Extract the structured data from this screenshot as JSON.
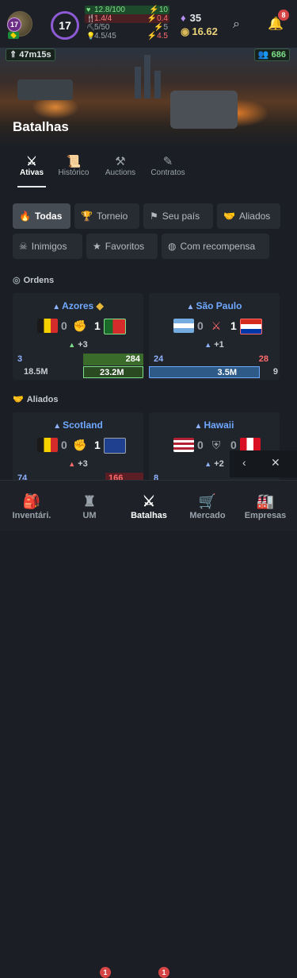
{
  "header": {
    "player_level": "17",
    "level": "17",
    "stats": [
      {
        "left": "12.8/100",
        "right": "10"
      },
      {
        "left": "1.4/4",
        "right": "0.4"
      },
      {
        "left": "5/50",
        "right": "5"
      },
      {
        "left": "4.5/45",
        "right": "4.5"
      }
    ],
    "gems": "35",
    "coins": "16.62",
    "notifications": "8",
    "timer": "47m15s",
    "online": "686"
  },
  "hero": {
    "title": "Batalhas"
  },
  "tabs": [
    {
      "label": "Ativas"
    },
    {
      "label": "Histórico"
    },
    {
      "label": "Auctions"
    },
    {
      "label": "Contratos"
    }
  ],
  "filters": [
    {
      "label": "Todas"
    },
    {
      "label": "Torneio"
    },
    {
      "label": "Seu país"
    },
    {
      "label": "Aliados"
    },
    {
      "label": "Inimigos"
    },
    {
      "label": "Favoritos"
    },
    {
      "label": "Com recompensa"
    }
  ],
  "sections": {
    "orders": "Ordens",
    "allies": "Aliados"
  },
  "battles": [
    {
      "name": "Azores",
      "left_score": "0",
      "right_score": "1",
      "bonus": "+3",
      "left_count": "3",
      "right_count": "284",
      "left_damage": "18.5M",
      "right_damage": "23.2M"
    },
    {
      "name": "São Paulo",
      "left_score": "0",
      "right_score": "1",
      "bonus": "+1",
      "left_count": "24",
      "right_count": "28",
      "left_damage": "3.5M",
      "right_damage": "9"
    },
    {
      "name": "Scotland",
      "left_score": "0",
      "right_score": "1",
      "bonus": "+3",
      "left_count": "74",
      "right_count": "166"
    },
    {
      "name": "Hawaii",
      "left_score": "0",
      "right_score": "0",
      "bonus": "+2",
      "left_count": "8",
      "right_count": ""
    }
  ],
  "nav": [
    {
      "label": "Inventári."
    },
    {
      "label": "UM",
      "badge": "1"
    },
    {
      "label": "Batalhas",
      "badge": "1"
    },
    {
      "label": "Mercado"
    },
    {
      "label": "Empresas"
    }
  ],
  "colors": {
    "accent": "#6fa8ff",
    "green": "#7fe08a",
    "red": "#ff6b6b",
    "purple": "#8e5bd6"
  }
}
